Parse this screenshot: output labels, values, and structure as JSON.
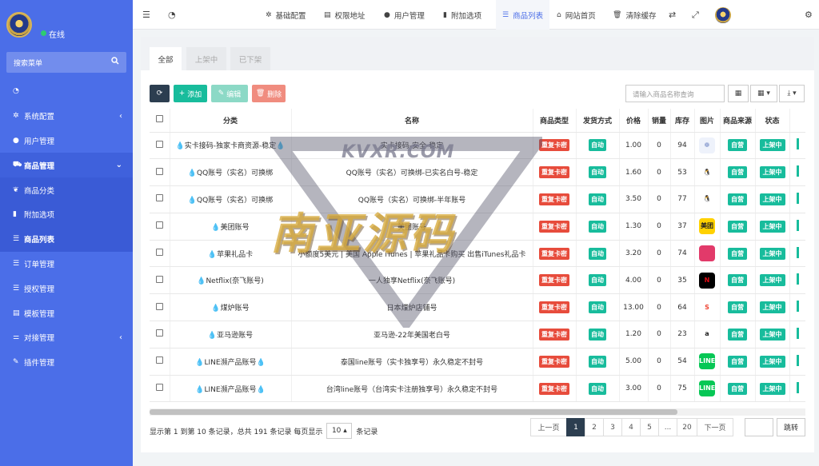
{
  "sidebar": {
    "status": "在线",
    "search_placeholder": "搜索菜单",
    "items": [
      {
        "icon": "dashboard-icon",
        "label": "",
        "caret": ""
      },
      {
        "icon": "gear-icon",
        "label": "系统配置",
        "caret": "‹"
      },
      {
        "icon": "user-icon",
        "label": "用户管理",
        "caret": ""
      },
      {
        "icon": "cart-icon",
        "label": "商品管理",
        "caret": "⌄"
      },
      {
        "icon": "leaf-icon",
        "label": "商品分类",
        "caret": ""
      },
      {
        "icon": "bookmark-icon",
        "label": "附加选项",
        "caret": ""
      },
      {
        "icon": "list-icon",
        "label": "商品列表",
        "caret": ""
      },
      {
        "icon": "list-icon",
        "label": "订单管理",
        "caret": ""
      },
      {
        "icon": "list-icon",
        "label": "授权管理",
        "caret": ""
      },
      {
        "icon": "template-icon",
        "label": "模板管理",
        "caret": ""
      },
      {
        "icon": "sliders-icon",
        "label": "对接管理",
        "caret": "‹"
      },
      {
        "icon": "plugin-icon",
        "label": "插件管理",
        "caret": ""
      }
    ]
  },
  "topnav": {
    "items": [
      {
        "icon": "gear-icon",
        "label": "基础配置"
      },
      {
        "icon": "list-icon",
        "label": "权限地址"
      },
      {
        "icon": "user-icon",
        "label": "用户管理"
      },
      {
        "icon": "bookmark-icon",
        "label": "附加选项"
      },
      {
        "icon": "list-icon",
        "label": "商品列表"
      },
      {
        "icon": "home-icon",
        "label": "网站首页"
      },
      {
        "icon": "trash-icon",
        "label": "清除缓存"
      }
    ]
  },
  "tabs": [
    "全部",
    "上架中",
    "已下架"
  ],
  "toolbar": {
    "refresh": "⟳",
    "add": "添加",
    "edit": "编辑",
    "delete": "删除",
    "search_placeholder": "请输入商品名称查询"
  },
  "table": {
    "headers": [
      "分类",
      "名称",
      "商品类型",
      "发货方式",
      "价格",
      "销量",
      "库存",
      "图片",
      "商品来源",
      "状态"
    ],
    "rows": [
      {
        "category": "💧实卡接码-独家卡商资源-稳定💧",
        "name": "实卡接码-安全-稳定",
        "type": "重复卡密",
        "delivery": "自动",
        "price": "1.00",
        "sales": "0",
        "stock": "94",
        "pic": "pic-generic",
        "source": "自营",
        "status": "上架中"
      },
      {
        "category": "💧QQ账号（实名）可换绑",
        "name": "QQ账号（实名）可换绑-已实名白号-稳定",
        "type": "重复卡密",
        "delivery": "自动",
        "price": "1.60",
        "sales": "0",
        "stock": "53",
        "pic": "pic-qq",
        "source": "自营",
        "status": "上架中"
      },
      {
        "category": "💧QQ账号（实名）可换绑",
        "name": "QQ账号（实名）可换绑-半年账号",
        "type": "重复卡密",
        "delivery": "自动",
        "price": "3.50",
        "sales": "0",
        "stock": "77",
        "pic": "pic-qq",
        "source": "自营",
        "status": "上架中"
      },
      {
        "category": "💧美团账号",
        "name": "美团账号",
        "type": "重复卡密",
        "delivery": "自动",
        "price": "1.30",
        "sales": "0",
        "stock": "37",
        "pic": "pic-meituan",
        "source": "自营",
        "status": "上架中"
      },
      {
        "category": "💧苹果礼品卡",
        "name": "小额度5美元 | 美国 Apple iTunes | 苹果礼品卡购买 出售iTunes礼品卡",
        "type": "重复卡密",
        "delivery": "自动",
        "price": "3.20",
        "sales": "0",
        "stock": "74",
        "pic": "pic-apple",
        "source": "自营",
        "status": "上架中"
      },
      {
        "category": "💧Netflix(奈飞账号)",
        "name": "一人独享Netflix(奈飞账号)",
        "type": "重复卡密",
        "delivery": "自动",
        "price": "4.00",
        "sales": "0",
        "stock": "35",
        "pic": "pic-netflix",
        "source": "自营",
        "status": "上架中"
      },
      {
        "category": "💧煤炉账号",
        "name": "日本煤炉店铺号",
        "type": "重复卡密",
        "delivery": "自动",
        "price": "13.00",
        "sales": "0",
        "stock": "64",
        "pic": "pic-mercari",
        "source": "自营",
        "status": "上架中"
      },
      {
        "category": "💧亚马逊账号",
        "name": "亚马逊-22年美国老白号",
        "type": "重复卡密",
        "delivery": "自动",
        "price": "1.20",
        "sales": "0",
        "stock": "23",
        "pic": "pic-amazon",
        "source": "自营",
        "status": "上架中"
      },
      {
        "category": "💧LINE濒产品账号💧",
        "name": "泰国line账号（实卡独享号）永久稳定不封号",
        "type": "重复卡密",
        "delivery": "自动",
        "price": "5.00",
        "sales": "0",
        "stock": "54",
        "pic": "pic-line",
        "source": "自营",
        "status": "上架中"
      },
      {
        "category": "💧LINE濒产品账号💧",
        "name": "台湾line账号（台湾实卡注册独享号）永久稳定不封号",
        "type": "重复卡密",
        "delivery": "自动",
        "price": "3.00",
        "sales": "0",
        "stock": "75",
        "pic": "pic-line",
        "source": "自营",
        "status": "上架中"
      }
    ]
  },
  "footer": {
    "info_prefix": "显示第 1 到第 10 条记录，总共 191 条记录 每页显示",
    "page_size": "10",
    "info_suffix": "条记录"
  },
  "pager": {
    "prev": "上一页",
    "pages": [
      "1",
      "2",
      "3",
      "4",
      "5",
      "...",
      "20"
    ],
    "next": "下一页",
    "jump": "跳转"
  },
  "watermark": {
    "latin": "KVXR.COM",
    "chinese": "南亚源码"
  },
  "colors": {
    "sidebar": "#4b6ee8",
    "badge_red": "#e74c3c",
    "badge_green": "#18bc9c",
    "dark": "#2c3e50"
  }
}
